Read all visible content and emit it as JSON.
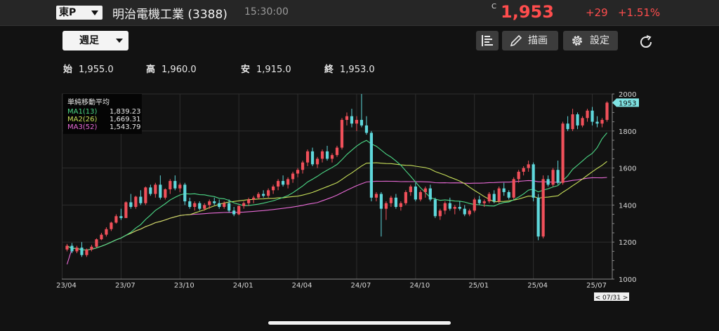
{
  "header": {
    "market": "東P",
    "stock_name": "明治電機工業 (3388)",
    "time": "15:30:00",
    "c_mark": "C",
    "price": "1,953",
    "change": "+29",
    "change_pct": "+1.51%"
  },
  "toolbar": {
    "period": "週足",
    "draw_label": "描画",
    "settings_label": "設定"
  },
  "ohlc": {
    "open_label": "始",
    "open": "1,955.0",
    "high_label": "高",
    "high": "1,960.0",
    "low_label": "安",
    "low": "1,915.0",
    "close_label": "終",
    "close": "1,953.0"
  },
  "legend": {
    "title": "単純移動平均",
    "items": [
      {
        "name": "MA1(13)",
        "value": "1,839.23",
        "color": "#4cd987"
      },
      {
        "name": "MA2(26)",
        "value": "1,669.31",
        "color": "#c8e05a"
      },
      {
        "name": "MA3(52)",
        "value": "1,543.79",
        "color": "#e86ad6"
      }
    ]
  },
  "colors": {
    "up": "#f0505a",
    "down": "#5fd8dc",
    "price_label_bg": "#7fe3e3"
  },
  "chart_data": {
    "type": "candlestick",
    "ylim": [
      1000,
      2000
    ],
    "y_ticks": [
      1000,
      1200,
      1400,
      1600,
      1800,
      2000
    ],
    "x_ticks": [
      "23/04",
      "23/07",
      "23/10",
      "24/01",
      "24/04",
      "24/07",
      "24/10",
      "25/01",
      "25/04",
      "25/07"
    ],
    "last_price_label": "1953",
    "cursor_date_label": "< 07/31 >",
    "grid": true,
    "candles": [
      [
        1160,
        1190,
        1150,
        1180
      ],
      [
        1180,
        1195,
        1140,
        1150
      ],
      [
        1150,
        1180,
        1140,
        1170
      ],
      [
        1170,
        1200,
        1120,
        1130
      ],
      [
        1130,
        1165,
        1120,
        1160
      ],
      [
        1160,
        1185,
        1150,
        1175
      ],
      [
        1175,
        1220,
        1170,
        1215
      ],
      [
        1215,
        1250,
        1210,
        1240
      ],
      [
        1240,
        1280,
        1230,
        1270
      ],
      [
        1270,
        1310,
        1260,
        1305
      ],
      [
        1305,
        1350,
        1300,
        1340
      ],
      [
        1340,
        1380,
        1320,
        1330
      ],
      [
        1330,
        1420,
        1330,
        1415
      ],
      [
        1415,
        1460,
        1380,
        1390
      ],
      [
        1390,
        1450,
        1380,
        1445
      ],
      [
        1445,
        1480,
        1400,
        1410
      ],
      [
        1410,
        1500,
        1400,
        1495
      ],
      [
        1495,
        1510,
        1450,
        1460
      ],
      [
        1460,
        1520,
        1440,
        1510
      ],
      [
        1510,
        1560,
        1430,
        1440
      ],
      [
        1440,
        1490,
        1430,
        1485
      ],
      [
        1485,
        1540,
        1460,
        1530
      ],
      [
        1530,
        1560,
        1480,
        1490
      ],
      [
        1490,
        1520,
        1470,
        1510
      ],
      [
        1510,
        1520,
        1400,
        1420
      ],
      [
        1420,
        1440,
        1380,
        1390
      ],
      [
        1390,
        1420,
        1370,
        1410
      ],
      [
        1410,
        1420,
        1370,
        1380
      ],
      [
        1380,
        1410,
        1370,
        1400
      ],
      [
        1400,
        1430,
        1380,
        1420
      ],
      [
        1420,
        1440,
        1400,
        1410
      ],
      [
        1410,
        1430,
        1380,
        1390
      ],
      [
        1390,
        1420,
        1380,
        1410
      ],
      [
        1410,
        1430,
        1360,
        1370
      ],
      [
        1370,
        1390,
        1340,
        1350
      ],
      [
        1350,
        1400,
        1345,
        1395
      ],
      [
        1395,
        1420,
        1380,
        1410
      ],
      [
        1410,
        1440,
        1395,
        1430
      ],
      [
        1430,
        1450,
        1410,
        1440
      ],
      [
        1440,
        1470,
        1430,
        1460
      ],
      [
        1460,
        1480,
        1440,
        1450
      ],
      [
        1450,
        1490,
        1440,
        1480
      ],
      [
        1480,
        1510,
        1460,
        1500
      ],
      [
        1500,
        1540,
        1480,
        1530
      ],
      [
        1530,
        1560,
        1500,
        1510
      ],
      [
        1510,
        1550,
        1490,
        1540
      ],
      [
        1540,
        1580,
        1520,
        1570
      ],
      [
        1570,
        1600,
        1550,
        1590
      ],
      [
        1590,
        1640,
        1570,
        1630
      ],
      [
        1630,
        1700,
        1610,
        1690
      ],
      [
        1690,
        1710,
        1610,
        1620
      ],
      [
        1620,
        1660,
        1600,
        1650
      ],
      [
        1650,
        1700,
        1630,
        1690
      ],
      [
        1690,
        1720,
        1640,
        1650
      ],
      [
        1650,
        1680,
        1630,
        1670
      ],
      [
        1670,
        1720,
        1660,
        1710
      ],
      [
        1710,
        1870,
        1700,
        1860
      ],
      [
        1860,
        1900,
        1830,
        1880
      ],
      [
        1880,
        1920,
        1820,
        1840
      ],
      [
        1840,
        1880,
        1800,
        1860
      ],
      [
        1860,
        2000,
        1820,
        1830
      ],
      [
        1830,
        1880,
        1780,
        1790
      ],
      [
        1790,
        1800,
        1420,
        1440
      ],
      [
        1440,
        1470,
        1420,
        1460
      ],
      [
        1460,
        1470,
        1230,
        1380
      ],
      [
        1380,
        1420,
        1320,
        1410
      ],
      [
        1410,
        1450,
        1390,
        1440
      ],
      [
        1440,
        1460,
        1380,
        1390
      ],
      [
        1390,
        1420,
        1370,
        1410
      ],
      [
        1410,
        1480,
        1400,
        1470
      ],
      [
        1470,
        1510,
        1450,
        1500
      ],
      [
        1500,
        1520,
        1420,
        1430
      ],
      [
        1430,
        1480,
        1420,
        1470
      ],
      [
        1470,
        1500,
        1440,
        1490
      ],
      [
        1490,
        1510,
        1420,
        1430
      ],
      [
        1430,
        1440,
        1330,
        1340
      ],
      [
        1340,
        1380,
        1320,
        1370
      ],
      [
        1370,
        1420,
        1350,
        1410
      ],
      [
        1410,
        1440,
        1370,
        1380
      ],
      [
        1380,
        1400,
        1350,
        1390
      ],
      [
        1390,
        1420,
        1370,
        1380
      ],
      [
        1380,
        1400,
        1340,
        1350
      ],
      [
        1350,
        1380,
        1340,
        1370
      ],
      [
        1370,
        1440,
        1360,
        1430
      ],
      [
        1430,
        1450,
        1400,
        1410
      ],
      [
        1410,
        1430,
        1390,
        1420
      ],
      [
        1420,
        1470,
        1410,
        1460
      ],
      [
        1460,
        1480,
        1410,
        1420
      ],
      [
        1420,
        1500,
        1410,
        1490
      ],
      [
        1490,
        1520,
        1450,
        1470
      ],
      [
        1470,
        1480,
        1430,
        1440
      ],
      [
        1440,
        1550,
        1430,
        1540
      ],
      [
        1540,
        1590,
        1520,
        1580
      ],
      [
        1580,
        1610,
        1560,
        1600
      ],
      [
        1600,
        1640,
        1580,
        1620
      ],
      [
        1620,
        1630,
        1420,
        1440
      ],
      [
        1440,
        1460,
        1210,
        1230
      ],
      [
        1230,
        1560,
        1220,
        1540
      ],
      [
        1540,
        1560,
        1500,
        1510
      ],
      [
        1510,
        1600,
        1500,
        1590
      ],
      [
        1590,
        1640,
        1510,
        1520
      ],
      [
        1520,
        1850,
        1510,
        1840
      ],
      [
        1840,
        1880,
        1800,
        1810
      ],
      [
        1810,
        1920,
        1800,
        1890
      ],
      [
        1890,
        1900,
        1810,
        1830
      ],
      [
        1830,
        1880,
        1820,
        1870
      ],
      [
        1870,
        1920,
        1850,
        1910
      ],
      [
        1910,
        1930,
        1830,
        1850
      ],
      [
        1850,
        1880,
        1820,
        1840
      ],
      [
        1840,
        1870,
        1820,
        1860
      ],
      [
        1860,
        1960,
        1850,
        1953
      ]
    ],
    "ma1_label": "MA1(13)",
    "ma2_label": "MA2(26)",
    "ma3_label": "MA3(52)"
  }
}
